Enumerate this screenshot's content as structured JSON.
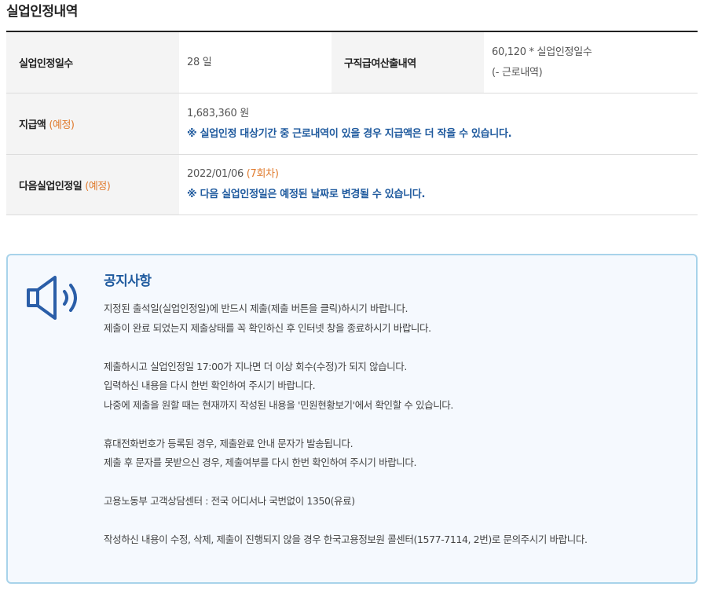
{
  "title": "실업인정내역",
  "table": {
    "row1": {
      "label": "실업인정일수",
      "value": "28 일",
      "label2": "구직급여산출내역",
      "calc_line1": "60,120 * 실업인정일수",
      "calc_line2": "(- 근로내역)"
    },
    "row2": {
      "label": "지급액",
      "label_tag": "(예정)",
      "value": "1,683,360 원",
      "note": "※ 실업인정 대상기간 중 근로내역이 있을 경우 지급액은 더 작을 수 있습니다."
    },
    "row3": {
      "label": "다음실업인정일",
      "label_tag": "(예정)",
      "value": "2022/01/06",
      "value_tag": "(7회차)",
      "note": "※ 다음 실업인정일은 예정된 날짜로 변경될 수 있습니다."
    }
  },
  "notice": {
    "icon": "speaker-icon",
    "title": "공지사항",
    "lines": [
      "지정된 출석일(실업인정일)에 반드시 제출(제출 버튼을 클릭)하시기 바랍니다.",
      "제출이 완료 되었는지 제출상태를 꼭 확인하신 후 인터넷 창을 종료하시기 바랍니다.",
      "",
      "제출하시고 실업인정일 17:00가 지나면 더 이상 회수(수정)가 되지 않습니다.",
      "입력하신 내용을 다시 한번 확인하여 주시기 바랍니다.",
      "나중에 제출을 원할 때는 현재까지 작성된 내용을 '민원현황보기'에서 확인할 수 있습니다.",
      "",
      "휴대전화번호가 등록된 경우, 제출완료 안내 문자가 발송됩니다.",
      "제출 후 문자를 못받으신 경우, 제출여부를 다시 한번 확인하여 주시기 바랍니다.",
      "",
      "고용노동부 고객상담센터 : 전국 어디서나 국번없이 1350(유료)",
      "",
      "작성하신 내용이 수정, 삭제, 제출이 진행되지 않을 경우 한국고용정보원 콜센터(1577-7114, 2번)로 문의주시기 바랍니다."
    ]
  },
  "colors": {
    "accent_blue": "#1f5a9e",
    "tag_orange": "#e07b2e",
    "notice_border": "#a8d3ea",
    "notice_bg": "#f5f9fe"
  }
}
